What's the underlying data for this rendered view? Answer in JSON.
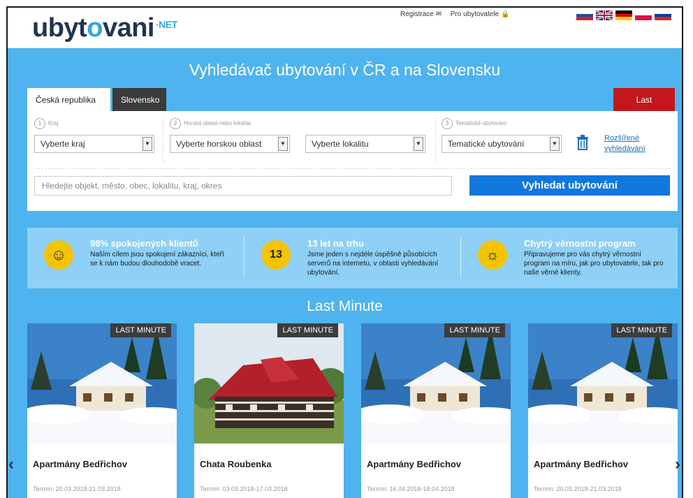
{
  "header": {
    "logo": {
      "main_a": "ubyt",
      "main_o": "o",
      "main_b": "vani",
      "suffix": "·NET"
    },
    "links": [
      "Registrace ✉",
      "Pro ubytovatele 🔒"
    ],
    "flags": [
      {
        "name": "slovakia-flag",
        "colors": [
          "#ffffff",
          "#1d4fa3",
          "#d21f2a"
        ]
      },
      {
        "name": "uk-flag",
        "colors": [
          "#0b2f7a",
          "#ffffff",
          "#c8102e"
        ]
      },
      {
        "name": "germany-flag",
        "colors": [
          "#000000",
          "#dd0000",
          "#ffce00"
        ]
      },
      {
        "name": "poland-flag",
        "colors": [
          "#ffffff",
          "#dc143c"
        ]
      },
      {
        "name": "russia-flag",
        "colors": [
          "#ffffff",
          "#0039a6",
          "#d52b1e"
        ]
      }
    ]
  },
  "hero": {
    "title": "Vyhledávač ubytování v ČR a na Slovensku"
  },
  "tabs": {
    "cz": "Česká republika",
    "sk": "Slovensko",
    "last_minute": "Last Minute!"
  },
  "search": {
    "kraj_label": "Kraj",
    "horska_label": "Horská oblast nebo lokalita",
    "tematicke_label": "Tematické ubytování",
    "num1": "1",
    "num2": "2",
    "num3": "3",
    "kraj_value": "Vyberte kraj",
    "horska_value": "Vyberte horskou oblast",
    "lokalita_value": "Vyberte lokalitu",
    "tematicke_value": "Tematické ubytování",
    "advanced_line1": "Rozšířené",
    "advanced_line2": "vyhledávání",
    "placeholder": "Hledejte objekt, město, obec, lokalitu, kraj, okres",
    "button": "Vyhledat ubytování"
  },
  "features": [
    {
      "icon": "smile-icon",
      "glyph": "☺",
      "title": "98% spokojených klientů",
      "text": "Naším cílem jsou spokojení zákazníci, kteří se k nám budou dlouhodobě vracet."
    },
    {
      "icon": "years-badge-icon",
      "glyph": "13",
      "title": "13 let na trhu",
      "text": "Jsme jeden s nejdéle úspěšně působících serverů na internetu, v oblasti vyhledávání ubytování."
    },
    {
      "icon": "idea-person-icon",
      "glyph": "☼",
      "title": "Chytrý věrnostní program",
      "text": "Připravujeme pro vás chytrý věrnostní program na míru, jak pro ubytovatele, tak pro naše věrné klienty."
    }
  ],
  "last_minute": {
    "title": "Last Minute",
    "badge": "LAST MINUTE",
    "cards": [
      {
        "name": "Apartmány Bedřichov",
        "term": "Termín: 20.03.2018-21.03.2018",
        "image": "snowy-chalet"
      },
      {
        "name": "Chata Roubenka",
        "term": "Termín: 03.03.2018-17.03.2018",
        "image": "red-roof-chalet"
      },
      {
        "name": "Apartmány Bedřichov",
        "term": "Termín: 16.04.2018-18.04.2018",
        "image": "snowy-chalet"
      },
      {
        "name": "Apartmány Bedřichov",
        "term": "Termín: 20.03.2018-21.03.2018",
        "image": "snowy-chalet"
      }
    ]
  },
  "colors": {
    "brand_blue": "#4eb3ee",
    "button_blue": "#1277dd",
    "last_minute_red": "#c4161c",
    "feature_yellow": "#f5c400"
  }
}
